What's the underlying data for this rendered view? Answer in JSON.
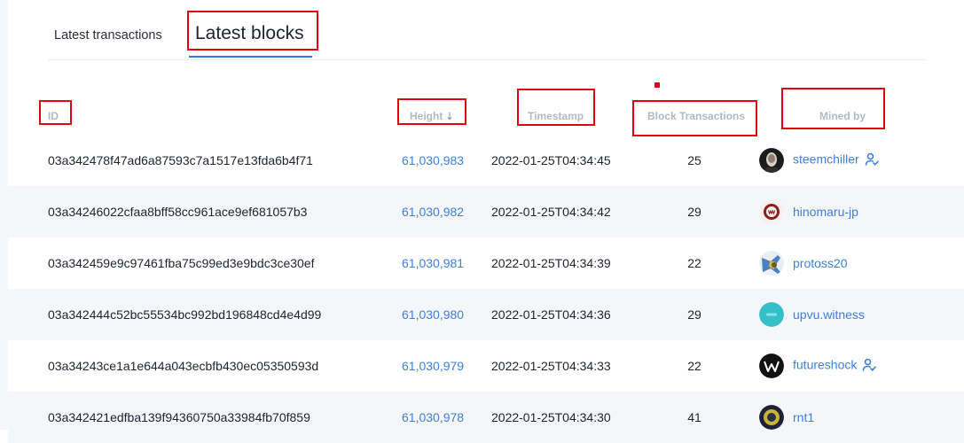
{
  "tabs": [
    {
      "label": "Latest transactions",
      "active": false
    },
    {
      "label": "Latest blocks",
      "active": true
    }
  ],
  "table": {
    "headers": {
      "id": "ID",
      "height": "Height",
      "timestamp": "Timestamp",
      "block_transactions": "Block Transactions",
      "mined_by": "Mined by"
    },
    "rows": [
      {
        "id": "03a342478f47ad6a87593c7a1517e13fda6b4f71",
        "height": "61,030,983",
        "timestamp": "2022-01-25T04:34:45",
        "tx": "25",
        "miner": "steemchiller",
        "verified": true
      },
      {
        "id": "03a34246022cfaa8bff58cc961ace9ef681057b3",
        "height": "61,030,982",
        "timestamp": "2022-01-25T04:34:42",
        "tx": "29",
        "miner": "hinomaru-jp",
        "verified": false
      },
      {
        "id": "03a342459e9c97461fba75c99ed3e9bdc3ce30ef",
        "height": "61,030,981",
        "timestamp": "2022-01-25T04:34:39",
        "tx": "22",
        "miner": "protoss20",
        "verified": false
      },
      {
        "id": "03a342444c52bc55534bc992bd196848cd4e4d99",
        "height": "61,030,980",
        "timestamp": "2022-01-25T04:34:36",
        "tx": "29",
        "miner": "upvu.witness",
        "verified": false
      },
      {
        "id": "03a34243ce1a1e644a043ecbfb430ec05350593d",
        "height": "61,030,979",
        "timestamp": "2022-01-25T04:34:33",
        "tx": "22",
        "miner": "futureshock",
        "verified": true
      },
      {
        "id": "03a342421edfba139f94360750a33984fb70f859",
        "height": "61,030,978",
        "timestamp": "2022-01-25T04:34:30",
        "tx": "41",
        "miner": "rnt1",
        "verified": false
      }
    ]
  },
  "colors": {
    "link": "#3d7fe0",
    "tab_underline": "#2f7be5",
    "annotation": "#e3000f",
    "row_alt_bg": "#f4f6fa",
    "header_text": "#b3b8c2"
  },
  "icons": {
    "sort": "sort-descending-icon",
    "witness": "user-check-icon"
  }
}
